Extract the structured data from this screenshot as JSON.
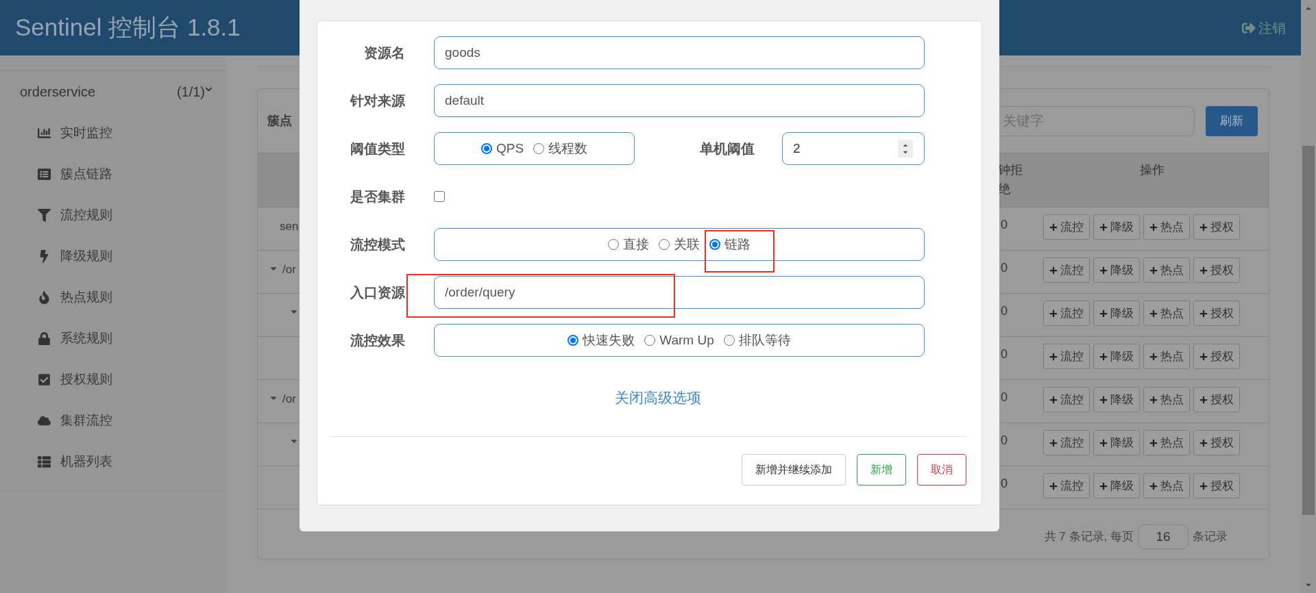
{
  "header": {
    "title": "Sentinel 控制台 1.8.1",
    "logout": "注销"
  },
  "sidebar": {
    "app": {
      "name": "orderservice",
      "count": "(1/1)",
      "expanded": true
    },
    "items": [
      {
        "label": "实时监控"
      },
      {
        "label": "簇点链路"
      },
      {
        "label": "流控规则"
      },
      {
        "label": "降级规则"
      },
      {
        "label": "热点规则"
      },
      {
        "label": "系统规则"
      },
      {
        "label": "授权规则"
      },
      {
        "label": "集群流控"
      },
      {
        "label": "机器列表"
      }
    ]
  },
  "card": {
    "title": "簇点",
    "search": {
      "placeholder": "关键字"
    },
    "refresh": "刷新",
    "columns": [
      "钟拒绝",
      "操作"
    ],
    "rows": [
      {
        "name": "sen",
        "value": "0",
        "actions": [
          "流控",
          "降级",
          "热点",
          "授权"
        ]
      },
      {
        "expanded": true,
        "name": "/or",
        "value": "0",
        "actions": [
          "流控",
          "降级",
          "热点",
          "授权"
        ],
        "children": [
          {
            "expanded": true,
            "value": "0",
            "actions": [
              "流控",
              "降级",
              "热点",
              "授权"
            ],
            "children": [
              {
                "value": "0",
                "actions": [
                  "流控",
                  "降级",
                  "热点",
                  "授权"
                ]
              }
            ]
          }
        ]
      },
      {
        "expanded": true,
        "name": "/or",
        "value": "0",
        "actions": [
          "流控",
          "降级",
          "热点",
          "授权"
        ],
        "children": [
          {
            "expanded": true,
            "value": "0",
            "actions": [
              "流控",
              "降级",
              "热点",
              "授权"
            ],
            "children": [
              {
                "value": "0",
                "actions": [
                  "流控",
                  "降级",
                  "热点",
                  "授权"
                ]
              }
            ]
          }
        ]
      }
    ],
    "pagination": {
      "prefix": "共 7 条记录, 每页",
      "page_size": "16",
      "suffix": "条记录"
    }
  },
  "dialog": {
    "resource_name": {
      "label": "资源名",
      "value": "goods"
    },
    "limit_app": {
      "label": "针对来源",
      "value": "default"
    },
    "threshold_type": {
      "label": "阈值类型",
      "options": [
        {
          "label": "QPS",
          "selected": true
        },
        {
          "label": "线程数",
          "selected": false
        }
      ]
    },
    "threshold": {
      "label": "单机阈值",
      "value": "2"
    },
    "cluster": {
      "label": "是否集群",
      "checked": false
    },
    "strategy": {
      "label": "流控模式",
      "options": [
        {
          "label": "直接",
          "selected": false
        },
        {
          "label": "关联",
          "selected": false
        },
        {
          "label": "链路",
          "selected": true
        }
      ]
    },
    "ref_resource": {
      "label": "入口资源",
      "value": "/order/query"
    },
    "control_behavior": {
      "label": "流控效果",
      "options": [
        {
          "label": "快速失败",
          "selected": true
        },
        {
          "label": "Warm Up",
          "selected": false
        },
        {
          "label": "排队等待",
          "selected": false
        }
      ]
    },
    "advanced_link": "关闭高级选项",
    "buttons": [
      {
        "kind": "default",
        "label": "新增并继续添加"
      },
      {
        "kind": "success",
        "label": "新增"
      },
      {
        "kind": "danger",
        "label": "取消"
      }
    ]
  }
}
